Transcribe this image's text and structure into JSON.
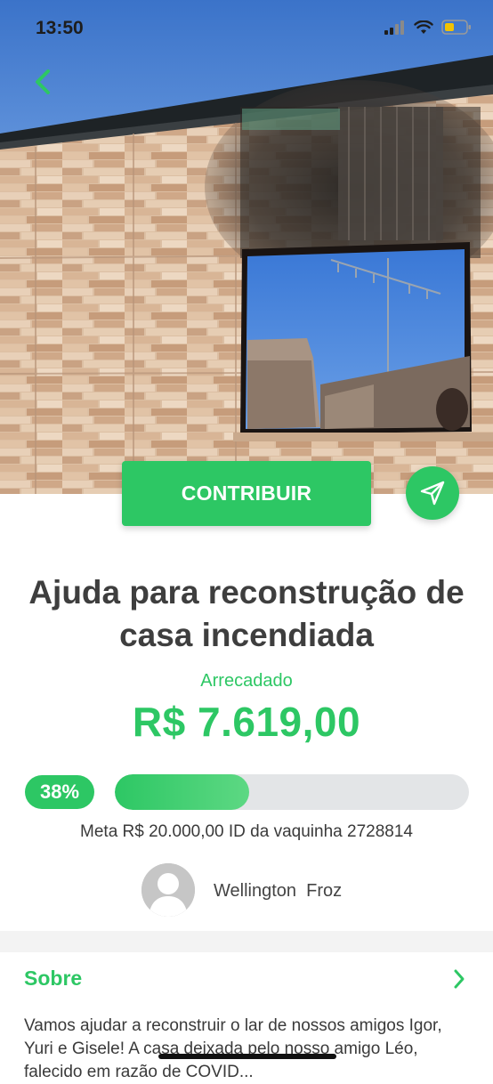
{
  "status_bar": {
    "time": "13:50"
  },
  "campaign": {
    "contribute_label": "CONTRIBUIR",
    "title": "Ajuda para reconstrução de casa incendiada",
    "raised_label": "Arrecadado",
    "raised_value": "R$ 7.619,00",
    "progress_percent_label": "38%",
    "progress_fraction": 0.38,
    "meta_line": "Meta R$ 20.000,00  ID da vaquinha 2728814",
    "organizer_name": "Wellington  Froz"
  },
  "about": {
    "label": "Sobre",
    "description": "Vamos ajudar a reconstruir o lar de nossos amigos Igor, Yuri e Gisele! A casa deixada pelo nosso amigo Léo, falecido em razão de COVID..."
  },
  "icons": {
    "back": "chevron-left-icon",
    "share": "paper-plane-icon",
    "sobre": "chevron-right-icon"
  },
  "colors": {
    "accent": "#2dc764",
    "progress_track": "#e3e5e7",
    "text": "#3e3e3e"
  }
}
